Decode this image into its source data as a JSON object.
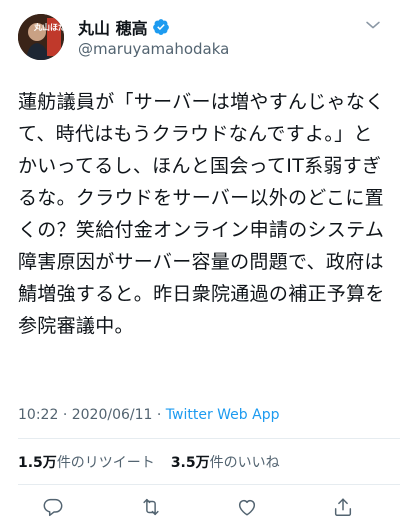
{
  "user": {
    "display_name": "丸山 穂高",
    "handle": "@maruyamahodaka",
    "avatar_text": "丸山ほだか"
  },
  "tweet": {
    "text": "蓮舫議員が「サーバーは増やすんじゃなくて、時代はもうクラウドなんですよ。」とかいってるし、ほんと国会ってIT系弱すぎるな。クラウドをサーバー以外のどこに置くの？笑給付金オンライン申請のシステム障害原因がサーバー容量の問題で、政府は鯖増強すると。昨日衆院通過の補正予算を参院審議中。",
    "time": "10:22",
    "date": "2020/06/11",
    "separator": "·",
    "source": "Twitter Web App"
  },
  "stats": {
    "retweets_count": "1.5万",
    "retweets_label": "件のリツイート",
    "likes_count": "3.5万",
    "likes_label": "件のいいね"
  },
  "colors": {
    "accent": "#1d9bf0",
    "text": "#0f1419",
    "muted": "#536471"
  },
  "icons": [
    "verified-badge-icon",
    "chevron-down-icon",
    "reply-icon",
    "retweet-icon",
    "like-icon",
    "share-icon"
  ]
}
